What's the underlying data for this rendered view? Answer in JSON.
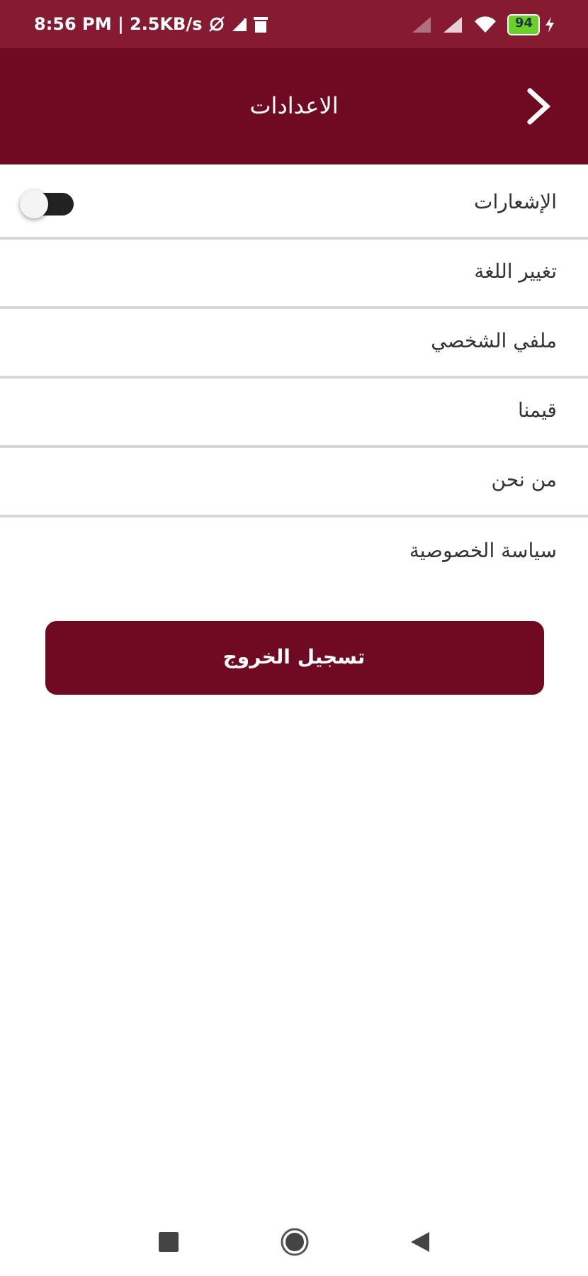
{
  "status_bar": {
    "time": "8:56 PM | 2.5KB/s",
    "battery": "94"
  },
  "header": {
    "title": "الاعدادات"
  },
  "settings": [
    {
      "kind": "toggle",
      "label": "الإشعارات",
      "on": false
    },
    {
      "kind": "link",
      "label": "تغيير اللغة"
    },
    {
      "kind": "link",
      "label": "ملفي الشخصي"
    },
    {
      "kind": "link",
      "label": "قيمنا"
    },
    {
      "kind": "link",
      "label": "من نحن"
    },
    {
      "kind": "link",
      "label": "سياسة الخصوصية"
    }
  ],
  "logout_button": "تسجيل الخروج"
}
